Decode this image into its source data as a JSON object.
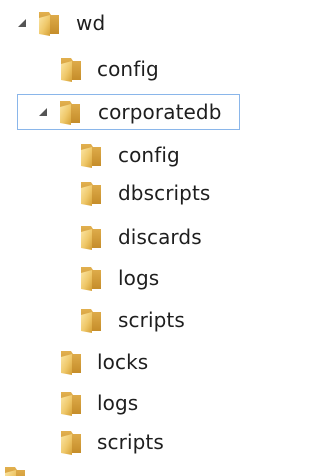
{
  "tree": {
    "items": [
      {
        "label": "wd",
        "expanded": true
      },
      {
        "label": "config"
      },
      {
        "label": "corporatedb",
        "expanded": true,
        "selected": true
      },
      {
        "label": "config"
      },
      {
        "label": "dbscripts"
      },
      {
        "label": "discards"
      },
      {
        "label": "logs"
      },
      {
        "label": "scripts"
      },
      {
        "label": "locks"
      },
      {
        "label": "logs"
      },
      {
        "label": "scripts"
      }
    ]
  },
  "colors": {
    "selection_border": "#8ab6ea",
    "folder_light": "#f6d98a",
    "folder_dark": "#d9a53a",
    "folder_shade": "#c7902c",
    "text": "#1e1e1e",
    "expander": "#555555"
  }
}
